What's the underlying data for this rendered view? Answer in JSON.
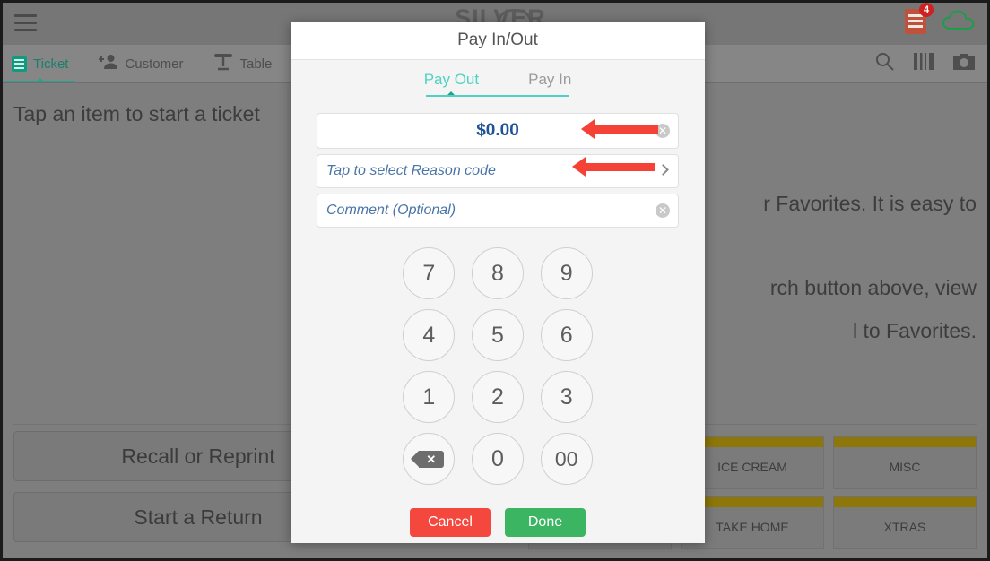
{
  "background": {
    "brand": {
      "name": "SILVER",
      "cloud_icon": "cloud-icon"
    },
    "topbar": {
      "menu_icon": "hamburger-menu-icon",
      "receipt_icon": "receipt-icon",
      "receipt_badge": "4",
      "cloud_icon": "cloud-sync-icon"
    },
    "tabs": [
      {
        "label": "Ticket",
        "icon": "ticket-icon",
        "active": true
      },
      {
        "label": "Customer",
        "icon": "add-customer-icon",
        "active": false
      },
      {
        "label": "Table",
        "icon": "table-icon",
        "active": false
      },
      {
        "label": "",
        "icon": "add-document-icon",
        "active": false
      }
    ],
    "toolbar_icons": [
      "search-icon",
      "barcode-icon",
      "camera-icon"
    ],
    "body_lines": [
      "Tap an item to start a ticket",
      "r Favorites. It is easy to",
      "rch button above, view",
      "l to Favorites."
    ],
    "buttons": [
      {
        "label": "Recall or Reprint"
      },
      {
        "label": "Start a Return"
      }
    ],
    "categories": [
      {
        "label": ""
      },
      {
        "label": "ICE CREAM"
      },
      {
        "label": "MISC"
      },
      {
        "label": ""
      },
      {
        "label": "TAKE HOME"
      },
      {
        "label": "XTRAS"
      }
    ],
    "category_bar_color": "#8d7708"
  },
  "modal": {
    "title": "Pay In/Out",
    "tabs": [
      {
        "label": "Pay Out",
        "active": true
      },
      {
        "label": "Pay In",
        "active": false
      }
    ],
    "accent_color": "#4fd2c2",
    "fields": {
      "amount": {
        "value": "$0.00",
        "clear_icon": "clear-circle-icon"
      },
      "reason": {
        "placeholder": "Tap to select Reason code",
        "chevron_icon": "chevron-right-icon"
      },
      "comment": {
        "placeholder": "Comment (Optional)",
        "clear_icon": "clear-circle-icon"
      }
    },
    "keypad": [
      {
        "label": "7"
      },
      {
        "label": "8"
      },
      {
        "label": "9"
      },
      {
        "label": "4"
      },
      {
        "label": "5"
      },
      {
        "label": "6"
      },
      {
        "label": "1"
      },
      {
        "label": "2"
      },
      {
        "label": "3"
      },
      {
        "label": "backspace-icon"
      },
      {
        "label": "0"
      },
      {
        "label": "00"
      }
    ],
    "actions": {
      "cancel_label": "Cancel",
      "cancel_color": "#f4483e",
      "done_label": "Done",
      "done_color": "#3cb563"
    }
  },
  "annotations": {
    "arrow_color": "#f44336",
    "arrows": [
      "amount-field-arrow",
      "reason-field-arrow"
    ]
  }
}
